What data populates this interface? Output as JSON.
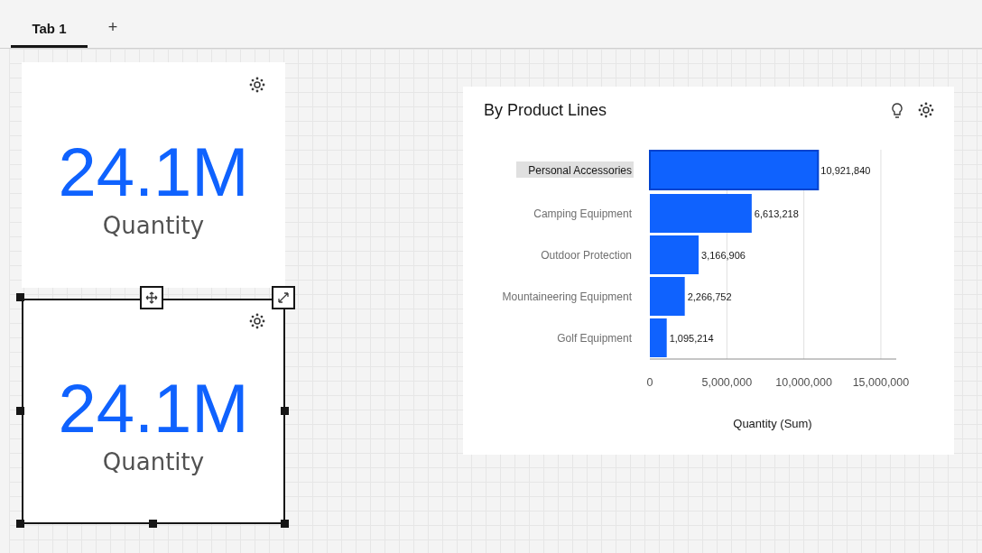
{
  "tabs": [
    {
      "label": "Tab 1",
      "selected": true
    }
  ],
  "add_tab": "+",
  "kpi_widgets": [
    {
      "value": "24.1M",
      "label": "Quantity",
      "selected": false
    },
    {
      "value": "24.1M",
      "label": "Quantity",
      "selected": true
    }
  ],
  "chart_widget": {
    "title": "By Product Lines",
    "selected": [
      true,
      false,
      false,
      false,
      false
    ],
    "chart_data": {
      "type": "bar",
      "orientation": "horizontal",
      "xlabel": "Quantity (Sum)",
      "categories": [
        "Personal Accessories",
        "Camping Equipment",
        "Outdoor Protection",
        "Mountaineering Equipment",
        "Golf Equipment"
      ],
      "grid": true,
      "series": [
        {
          "color": "#0f62fe",
          "values": [
            10921840,
            6613218,
            3166906,
            2266752,
            1095214
          ]
        }
      ],
      "value_labels": [
        "10,921,840",
        "6,613,218",
        "3,166,906",
        "2,266,752",
        "1,095,214"
      ],
      "xlim": [
        0,
        16000000
      ],
      "xticks": [
        {
          "value": 0,
          "label": "0"
        },
        {
          "value": 5000000,
          "label": "5,000,000"
        },
        {
          "value": 10000000,
          "label": "10,000,000"
        },
        {
          "value": 15000000,
          "label": "15,000,000"
        }
      ]
    }
  }
}
